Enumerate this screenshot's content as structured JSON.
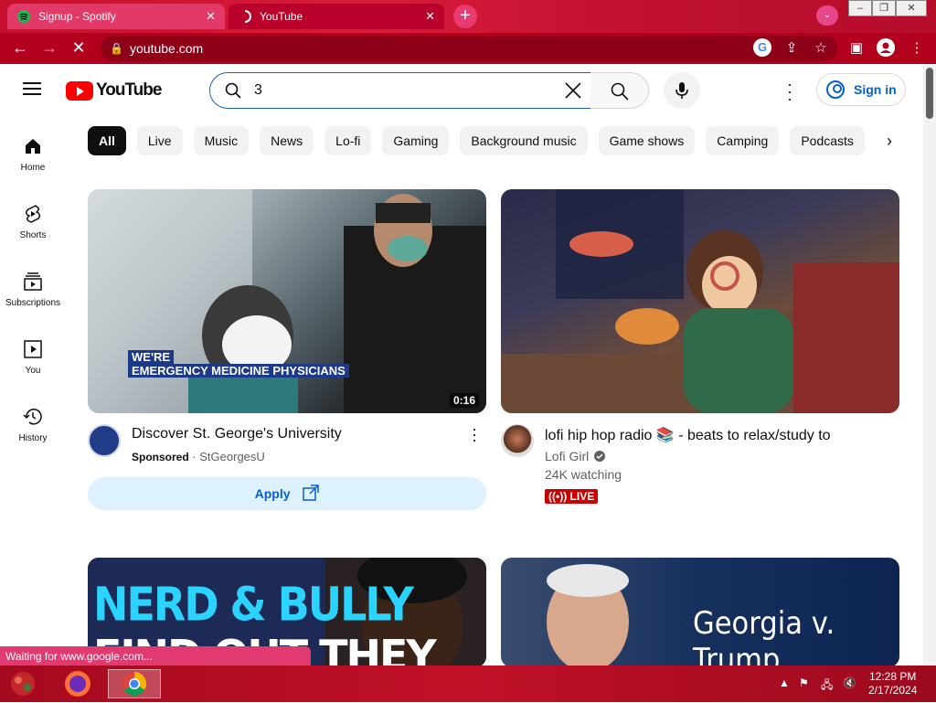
{
  "browser": {
    "tabs": [
      {
        "title": "Signup - Spotify"
      },
      {
        "title": "YouTube"
      }
    ],
    "new_tab": "+",
    "address": "youtube.com"
  },
  "youtube": {
    "logo_text": "YouTube",
    "search": {
      "value": "3"
    },
    "signin_label": "Sign in",
    "sidebar": [
      {
        "label": "Home",
        "icon": "home-icon"
      },
      {
        "label": "Shorts",
        "icon": "shorts-icon"
      },
      {
        "label": "Subscriptions",
        "icon": "subscriptions-icon"
      },
      {
        "label": "You",
        "icon": "you-icon"
      },
      {
        "label": "History",
        "icon": "history-icon"
      }
    ],
    "chips": [
      "All",
      "Live",
      "Music",
      "News",
      "Lo-fi",
      "Gaming",
      "Background music",
      "Game shows",
      "Camping",
      "Podcasts"
    ],
    "videos": [
      {
        "thumb_text": [
          "WE'RE",
          "EMERGENCY MEDICINE PHYSICIANS"
        ],
        "duration": "0:16",
        "title": "Discover St. George's University",
        "sponsored": "Sponsored",
        "separator": "·",
        "channel": "StGeorgesU",
        "action": "Apply"
      },
      {
        "title": "lofi hip hop radio 📚 - beats to relax/study to",
        "channel": "Lofi Girl",
        "viewers": "24K watching",
        "badge": "LIVE"
      },
      {
        "thumb_text": [
          "NERD & BULLY",
          "FIND OUT THEY"
        ]
      },
      {
        "thumb_text": [
          "Georgia v. Trump"
        ]
      }
    ]
  },
  "status_text": "Waiting for www.google.com...",
  "taskbar": {
    "time": "12:28 PM",
    "date": "2/17/2024"
  },
  "colors": {
    "accent_red": "#ff0000",
    "link_blue": "#065fd4",
    "browser_frame": "#c8102e"
  }
}
